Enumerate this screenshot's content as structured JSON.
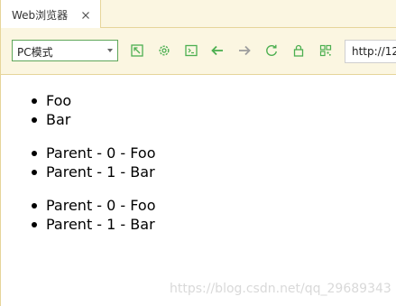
{
  "tab": {
    "title": "Web浏览器",
    "close_icon": "close-icon"
  },
  "toolbar": {
    "mode_select": {
      "selected": "PC模式"
    },
    "icons": [
      "external-link-icon",
      "gear-icon",
      "terminal-icon",
      "arrow-left-icon",
      "arrow-right-icon",
      "refresh-icon",
      "lock-icon",
      "qr-code-icon"
    ],
    "url": "http://12"
  },
  "content": {
    "lists": [
      {
        "items": [
          "Foo",
          "Bar"
        ]
      },
      {
        "items": [
          "Parent - 0 - Foo",
          "Parent - 1 - Bar"
        ]
      },
      {
        "items": [
          "Parent - 0 - Foo",
          "Parent - 1 - Bar"
        ]
      }
    ]
  },
  "watermark": "https://blog.csdn.net/qq_29689343",
  "colors": {
    "accent": "#4caf50",
    "chrome_bg": "#fbf6e1",
    "chrome_border": "#e6d59a",
    "disabled_icon": "#9e9e9e"
  }
}
